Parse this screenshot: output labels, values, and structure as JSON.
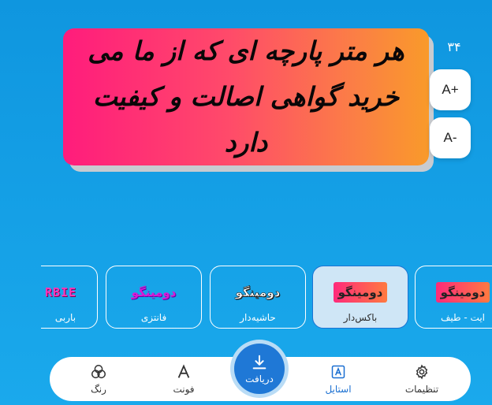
{
  "preview": {
    "text": "هر متر پارچه ای که از ما می خرید گواهی اصالت و کیفیت دارد",
    "font_size": "۳۴",
    "increase_label": "A+",
    "decrease_label": "A-",
    "gradient_start": "#ff1c7c",
    "gradient_end": "#f99a2a"
  },
  "styles": {
    "items": [
      {
        "sample": "دومینگو",
        "label": "ایت - طیف"
      },
      {
        "sample": "دومینگو",
        "label": "باکس‌دار",
        "selected": true
      },
      {
        "sample": "دومینگو",
        "label": "حاشیه‌دار"
      },
      {
        "sample": "دومینگو",
        "label": "فانتزی"
      },
      {
        "sample": "RBIE",
        "label": "باربی"
      }
    ]
  },
  "nav": {
    "settings": "تنظیمات",
    "style": "استایل",
    "download": "دریافت",
    "font": "فونت",
    "color": "رنگ",
    "active": "style",
    "accent": "#1a6fd1"
  }
}
